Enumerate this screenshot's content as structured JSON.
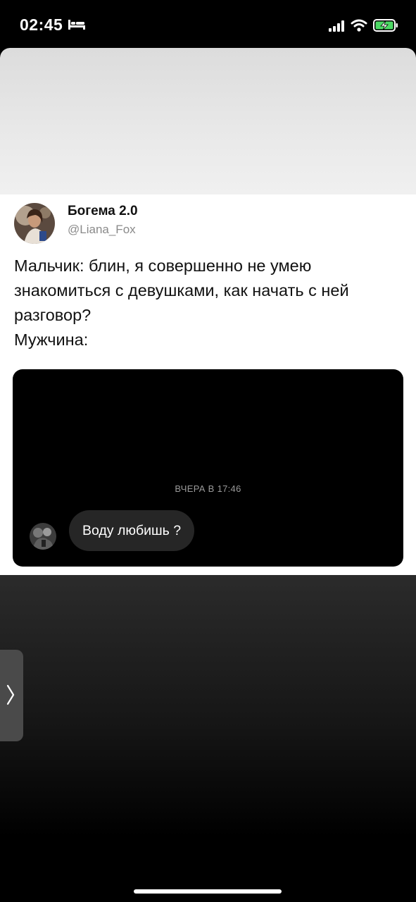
{
  "status_bar": {
    "time": "02:45",
    "icons": [
      "bed-icon",
      "signal-icon",
      "wifi-icon",
      "battery-charging-icon"
    ]
  },
  "tweet": {
    "display_name": "Богема 2.0",
    "handle": "@Liana_Fox",
    "text": "Мальчик: блин, я совершенно не умею знакомиться с девушками, как начать с ней разговор?\nМужчина:"
  },
  "chat": {
    "timestamp": "ВЧЕРА В 17:46",
    "message": "Воду любишь ?"
  },
  "navigation": {
    "side_handle_icon": "chevron-right-icon"
  },
  "colors": {
    "background": "#000000",
    "card": "#ffffff",
    "bubble": "#262626",
    "handle_text": "#8a8a8a"
  }
}
